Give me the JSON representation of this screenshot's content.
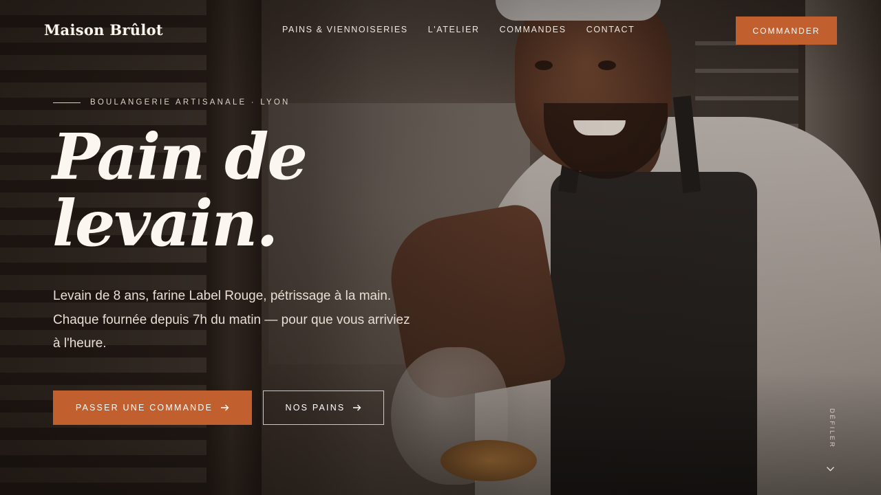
{
  "header": {
    "logo": "Maison Brûlot",
    "nav": [
      {
        "label": "PAINS & VIENNOISERIES"
      },
      {
        "label": "L'ATELIER"
      },
      {
        "label": "COMMANDES"
      },
      {
        "label": "CONTACT"
      }
    ],
    "cta_label": "COMMANDER"
  },
  "hero": {
    "eyebrow": "BOULANGERIE ARTISANALE · LYON",
    "headline_line1": "Pain de",
    "headline_line2": "levain.",
    "lede": "Levain de 8 ans, farine Label Rouge, pétrissage à la main. Chaque fournée depuis 7h du matin — pour que vous arriviez à l'heure.",
    "primary_button": "PASSER UNE COMMANDE",
    "secondary_button": "NOS PAINS",
    "scroll_label": "DÉFILER"
  },
  "icons": {
    "primary_arrow": "arrow-right-icon",
    "secondary_arrow": "arrow-right-icon",
    "scroll": "chevron-down-icon"
  },
  "colors": {
    "accent": "#c15f2f",
    "text": "#fbf6ef"
  }
}
